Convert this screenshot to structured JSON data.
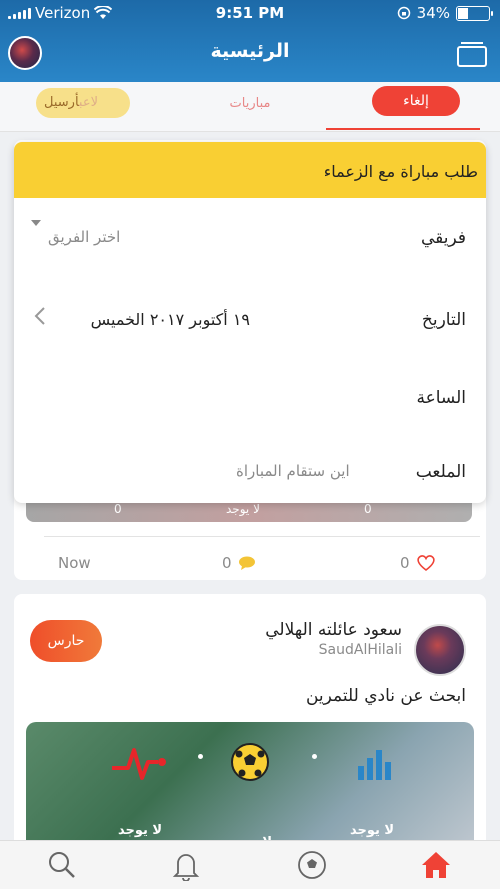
{
  "status": {
    "carrier": "Verizon",
    "time": "9:51 PM",
    "battery": "34%",
    "battery_level": 0.34
  },
  "nav": {
    "title": "الرئيسية"
  },
  "tabs": {
    "left": "لاعب",
    "left_overlay": "أرسيل",
    "middle": "مباريات",
    "right": "إلغاء"
  },
  "feed": {
    "now": "Now",
    "comments": "0",
    "likes": "0",
    "strip": [
      "لا يوجد",
      "0",
      "0"
    ]
  },
  "dialog": {
    "title": "طلب مباراة مع الزعماء",
    "team_label": "فريقي",
    "team_placeholder": "اختر الفريق",
    "date_label": "التاريخ",
    "date_value": "١٩ أكتوبر ٢٠١٧ الخميس",
    "time_label": "الساعة",
    "venue_label": "الملعب",
    "venue_placeholder": "اين ستقام المباراة"
  },
  "post": {
    "name": "سعود عائلته الهلالي",
    "username": "SaudAlHilali",
    "role": "حارس",
    "text": "ابحث عن نادي للتمرين",
    "stats": [
      {
        "label": "لا يوجد",
        "icon": "pulse-icon"
      },
      {
        "label": "لا يوجد",
        "icon": "soccer-ball-icon"
      },
      {
        "label": "لا يوجد",
        "icon": "bar-chart-icon"
      }
    ]
  },
  "colors": {
    "accent": "#ef4236",
    "header": "#2a86c8",
    "dialog_header": "#f9cf33"
  }
}
